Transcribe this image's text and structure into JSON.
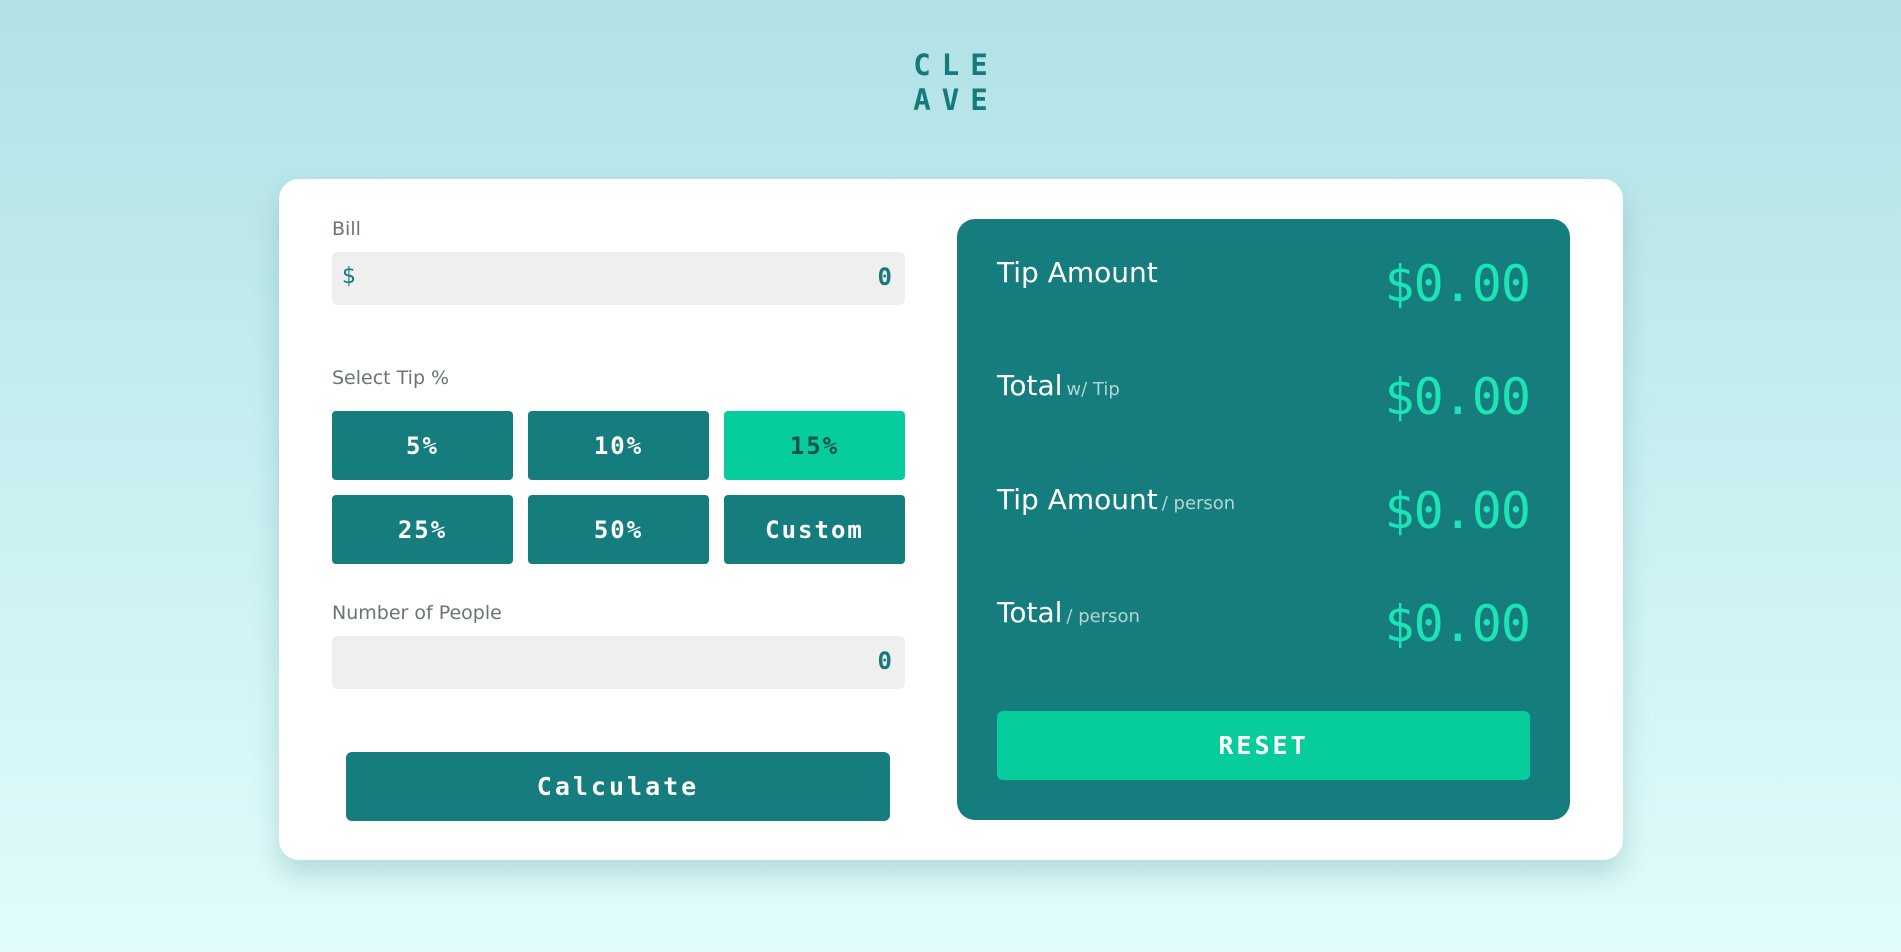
{
  "logo": {
    "line1": "CLE",
    "line2": "AVE"
  },
  "bill": {
    "label": "Bill",
    "prefix": "$",
    "value": "0"
  },
  "tip": {
    "label": "Select Tip %",
    "options": [
      "5%",
      "10%",
      "15%",
      "25%",
      "50%",
      "Custom"
    ],
    "selected": "15%"
  },
  "people": {
    "label": "Number of People",
    "value": "0"
  },
  "calculate_label": "Calculate",
  "results": [
    {
      "label": "Tip Amount",
      "sub": "",
      "value": "$0.00"
    },
    {
      "label": "Total",
      "sub": "w/ Tip",
      "value": "$0.00"
    },
    {
      "label": "Tip Amount",
      "sub": "/ person",
      "value": "$0.00"
    },
    {
      "label": "Total",
      "sub": "/ person",
      "value": "$0.00"
    }
  ],
  "reset_label": "RESET",
  "colors": {
    "primary": "#157d7e",
    "accent": "#06cd9b",
    "result_text": "#1de4b4",
    "background": "#c6eef0"
  }
}
